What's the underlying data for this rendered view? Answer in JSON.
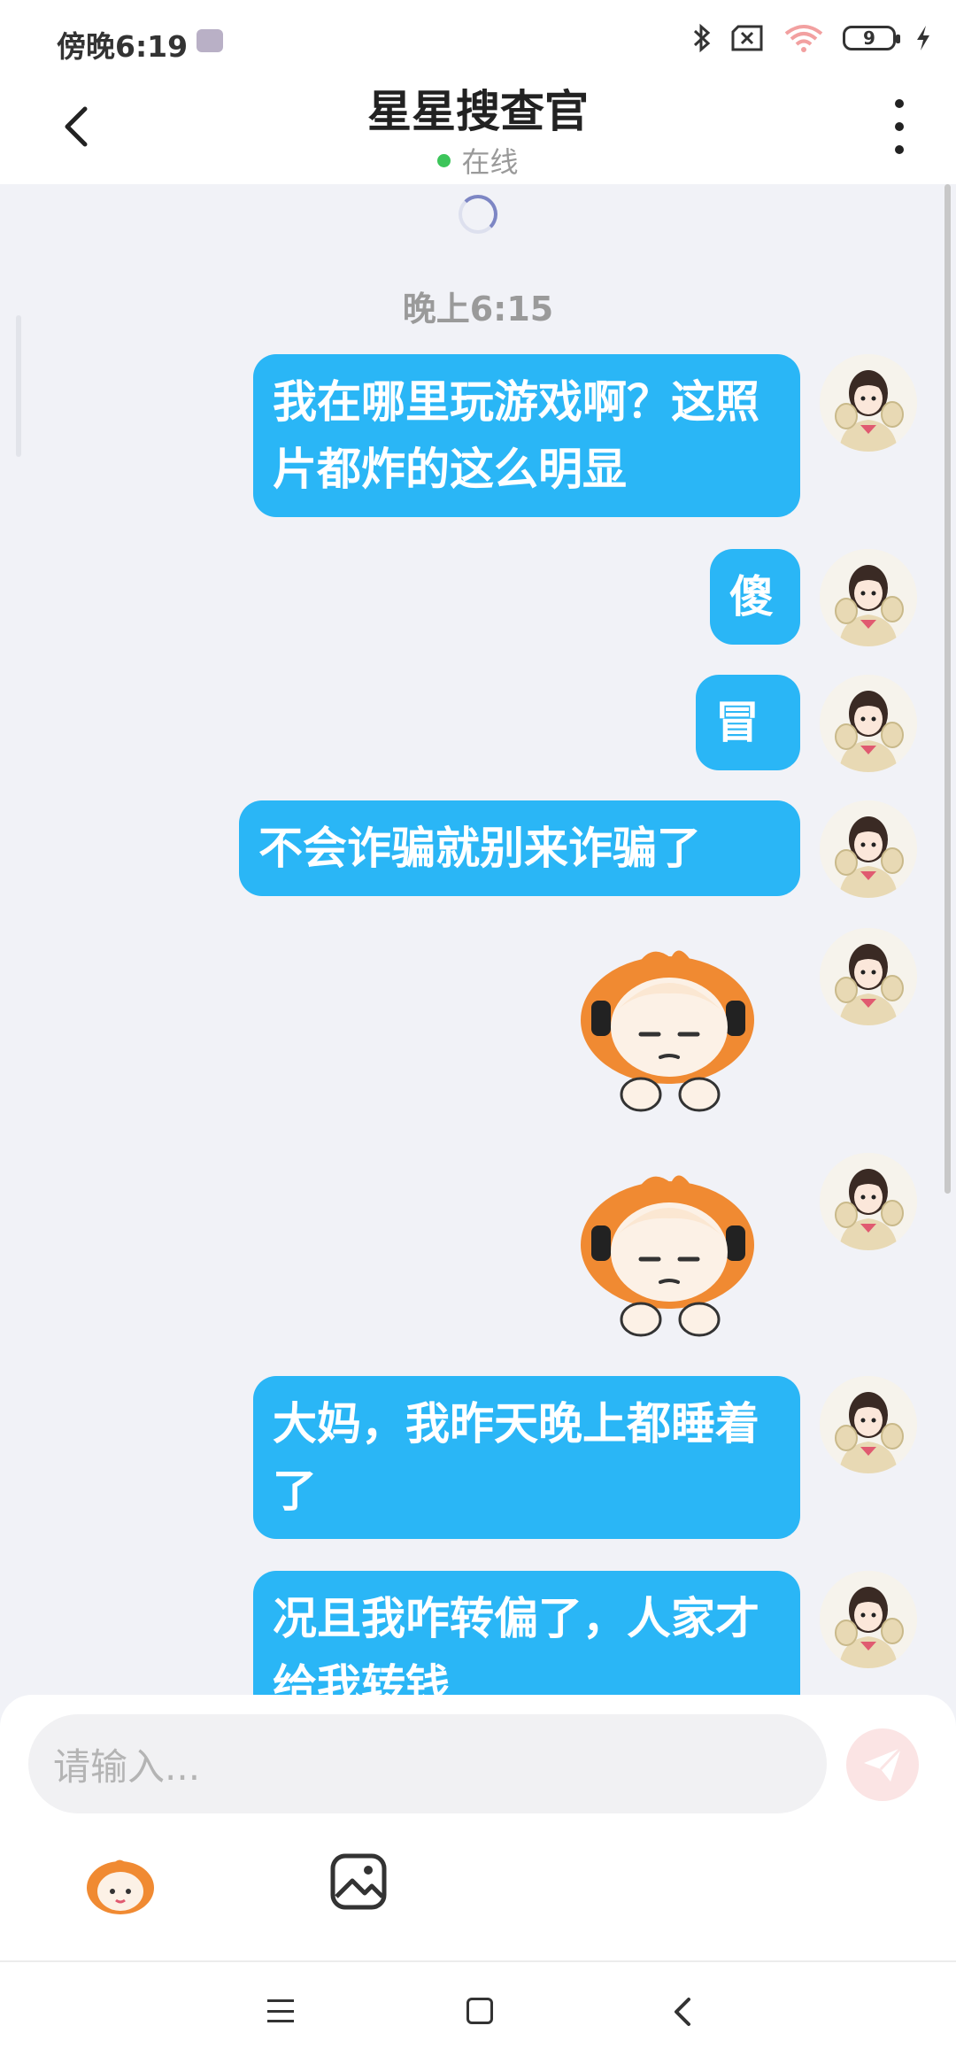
{
  "status_bar": {
    "time": "傍晚6:19",
    "battery_level": "9",
    "icons": [
      "bluetooth-icon",
      "sim-off-icon",
      "wifi-icon",
      "battery-icon",
      "charging-icon"
    ]
  },
  "header": {
    "title": "星星搜查官",
    "online_status": "在线",
    "online_color": "#3cc55a"
  },
  "chat": {
    "time_separator": "晚上6:15",
    "bubble_color": "#2ab6f6",
    "messages": [
      {
        "type": "text",
        "text": "我在哪里玩游戏啊？这照片都炸的这么明显"
      },
      {
        "type": "text",
        "text": "傻"
      },
      {
        "type": "text",
        "text": "冒"
      },
      {
        "type": "text",
        "text": "不会诈骗就别来诈骗了"
      },
      {
        "type": "sticker",
        "sticker": "sulky-orange-hair-girl-sticker"
      },
      {
        "type": "sticker",
        "sticker": "sulky-orange-hair-girl-sticker"
      },
      {
        "type": "text",
        "text": "大妈，我昨天晚上都睡着了"
      },
      {
        "type": "text",
        "text": "况且我咋转偏了，人家才给我转钱"
      }
    ]
  },
  "input": {
    "placeholder": "请输入...",
    "send_icon": "paper-plane-icon",
    "tools": [
      "emoji-sticker-icon",
      "image-icon"
    ]
  },
  "nav": {
    "icons": [
      "menu-icon",
      "home-icon",
      "back-icon"
    ]
  }
}
